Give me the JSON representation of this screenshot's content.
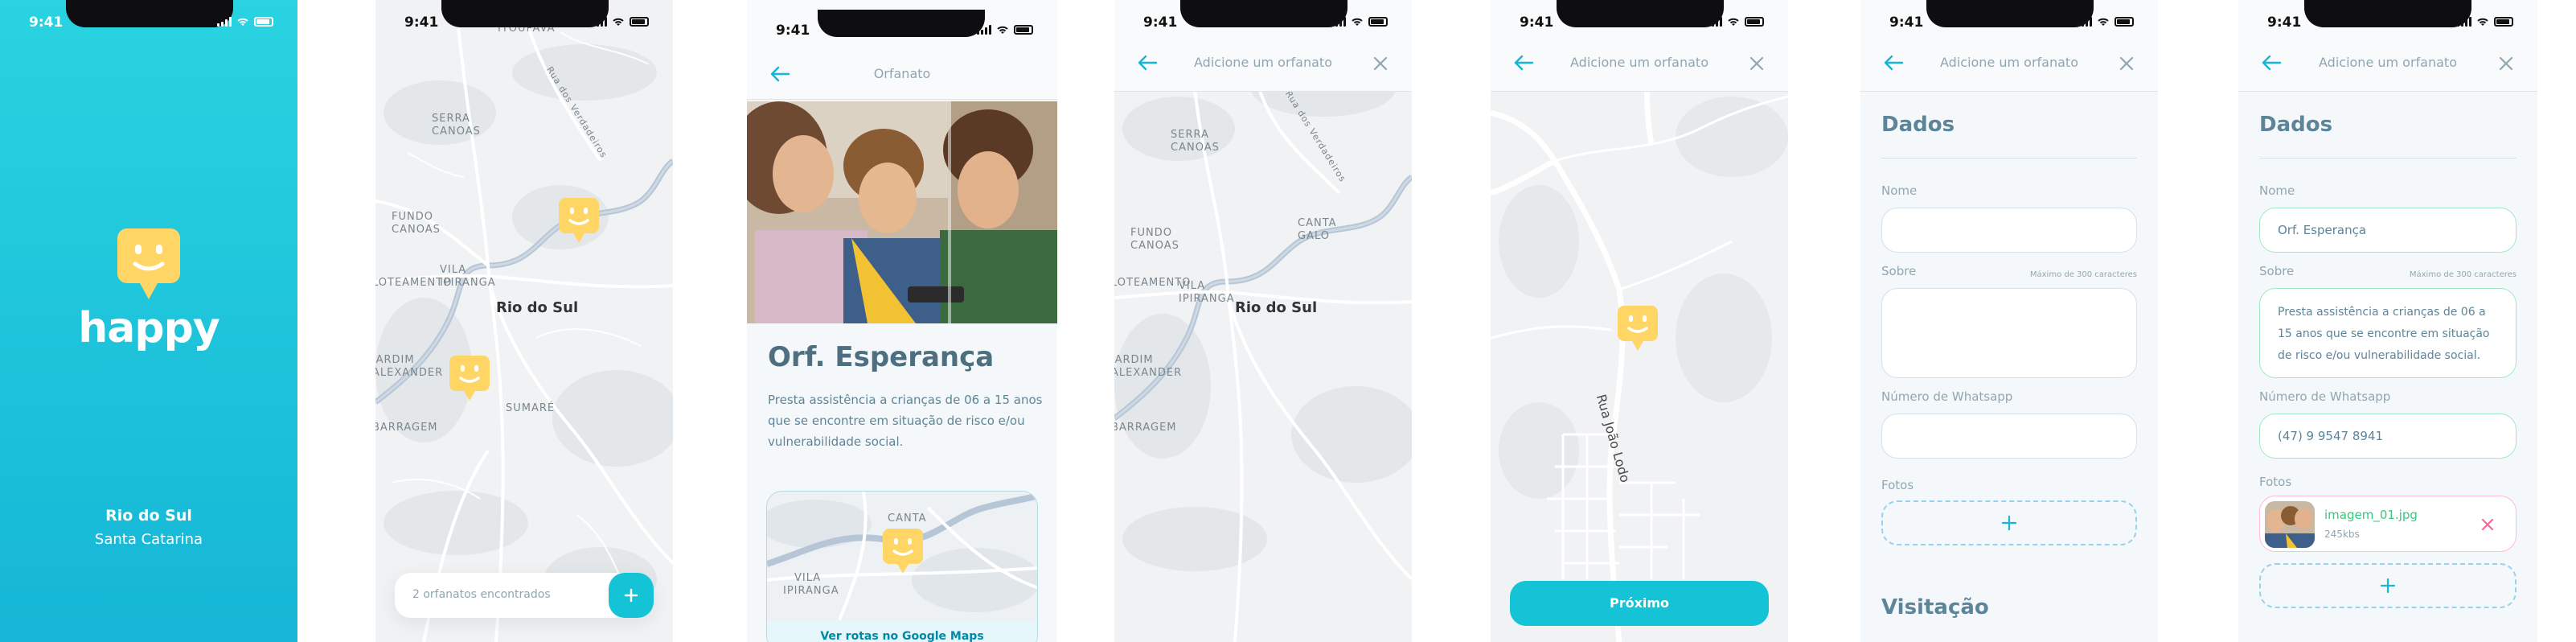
{
  "status": {
    "time": "9:41"
  },
  "splash": {
    "logo_text": "happy",
    "city": "Rio do Sul",
    "state": "Santa Catarina",
    "bg_top": "#2ad4e0",
    "bg_bottom": "#15b6d6"
  },
  "map": {
    "labels": {
      "itoupava": "ITOUPAVA",
      "rua_verdadeira": "Rua dos Verdadeiros",
      "serra_canoas": [
        "SERRA",
        "CANOAS"
      ],
      "fundo_canoas": [
        "FUNDO",
        "CANOAS"
      ],
      "canta_galo": [
        "CANTA",
        "GALO"
      ],
      "vila_ipiranga": [
        "VILA",
        "IPIRANGA"
      ],
      "loteamento": "LOTEAMENTO",
      "jardim_alexander": [
        "JARDIM",
        "ALEXANDER"
      ],
      "barragem": "BARRAGEM",
      "sumare": "SUMARÉ",
      "city": "Rio do Sul"
    },
    "found_text": "2 orfanatos encontrados",
    "add_icon": "plus-icon"
  },
  "detail": {
    "header_title": "Orfanato",
    "name": "Orf. Esperança",
    "description": "Presta assistência a crianças de 06 a 15 anos que se encontre em situação de risco e/ou vulnerabilidade social.",
    "routes_link": "Ver rotas no Google Maps",
    "mini_map_labels": {
      "canta": "CANTA",
      "vila": "VILA",
      "ipiranga": "IPIRANGA"
    }
  },
  "add_map": {
    "header_title": "Adicione um orfanato"
  },
  "add_select": {
    "header_title": "Adicione um orfanato",
    "street": "Rua João Lodo",
    "next_button": "Próximo"
  },
  "form_empty": {
    "header_title": "Adicione um orfanato",
    "section_data": "Dados",
    "name_label": "Nome",
    "about_label": "Sobre",
    "about_hint": "Máximo de 300 caracteres",
    "whatsapp_label": "Número de Whatsapp",
    "photos_label": "Fotos",
    "section_visit": "Visitação"
  },
  "form_filled": {
    "header_title": "Adicione um orfanato",
    "section_data": "Dados",
    "name_label": "Nome",
    "name_value": "Orf. Esperança",
    "about_label": "Sobre",
    "about_hint": "Máximo de 300 caracteres",
    "about_value": "Presta assistência a crianças de 06 a 15 anos que se encontre em situação de risco e/ou vulnerabilidade social.",
    "whatsapp_label": "Número de Whatsapp",
    "whatsapp_value": "(47) 9 9547 8941",
    "photos_label": "Fotos",
    "photo_file": "imagem_01.jpg",
    "photo_size": "245kbs"
  },
  "colors": {
    "primary": "#15c3d6",
    "pin": "#ffd666",
    "danger": "#ff669d",
    "success": "#37c77f"
  }
}
